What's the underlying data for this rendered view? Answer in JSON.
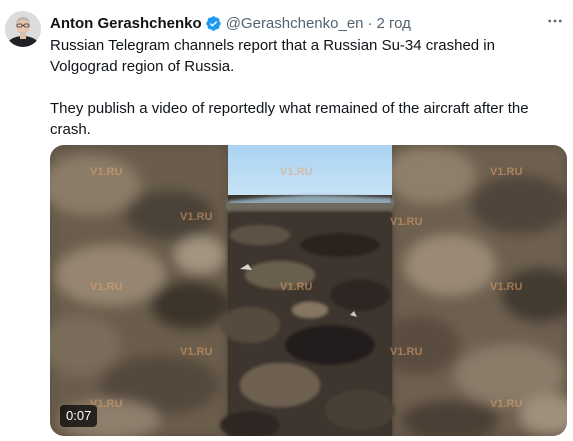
{
  "tweet": {
    "author": {
      "display_name": "Anton Gerashchenko",
      "handle": "@Gerashchenko_en",
      "verified": true,
      "avatar_icon": "avatar-photo"
    },
    "separator": "·",
    "timestamp": "2 год",
    "more_icon": "more-horizontal-icon",
    "text": {
      "paragraph_1": "Russian Telegram channels report that a Russian Su-34 crashed in Volgograd region of Russia.",
      "paragraph_2": "They publish a video of reportedly what remained of the aircraft after the crash."
    },
    "media": {
      "type": "video",
      "duration": "0:07",
      "watermark": "V1.RU"
    }
  },
  "colors": {
    "text_primary": "#0f1419",
    "text_secondary": "#536471",
    "verified_blue": "#1d9bf0"
  }
}
